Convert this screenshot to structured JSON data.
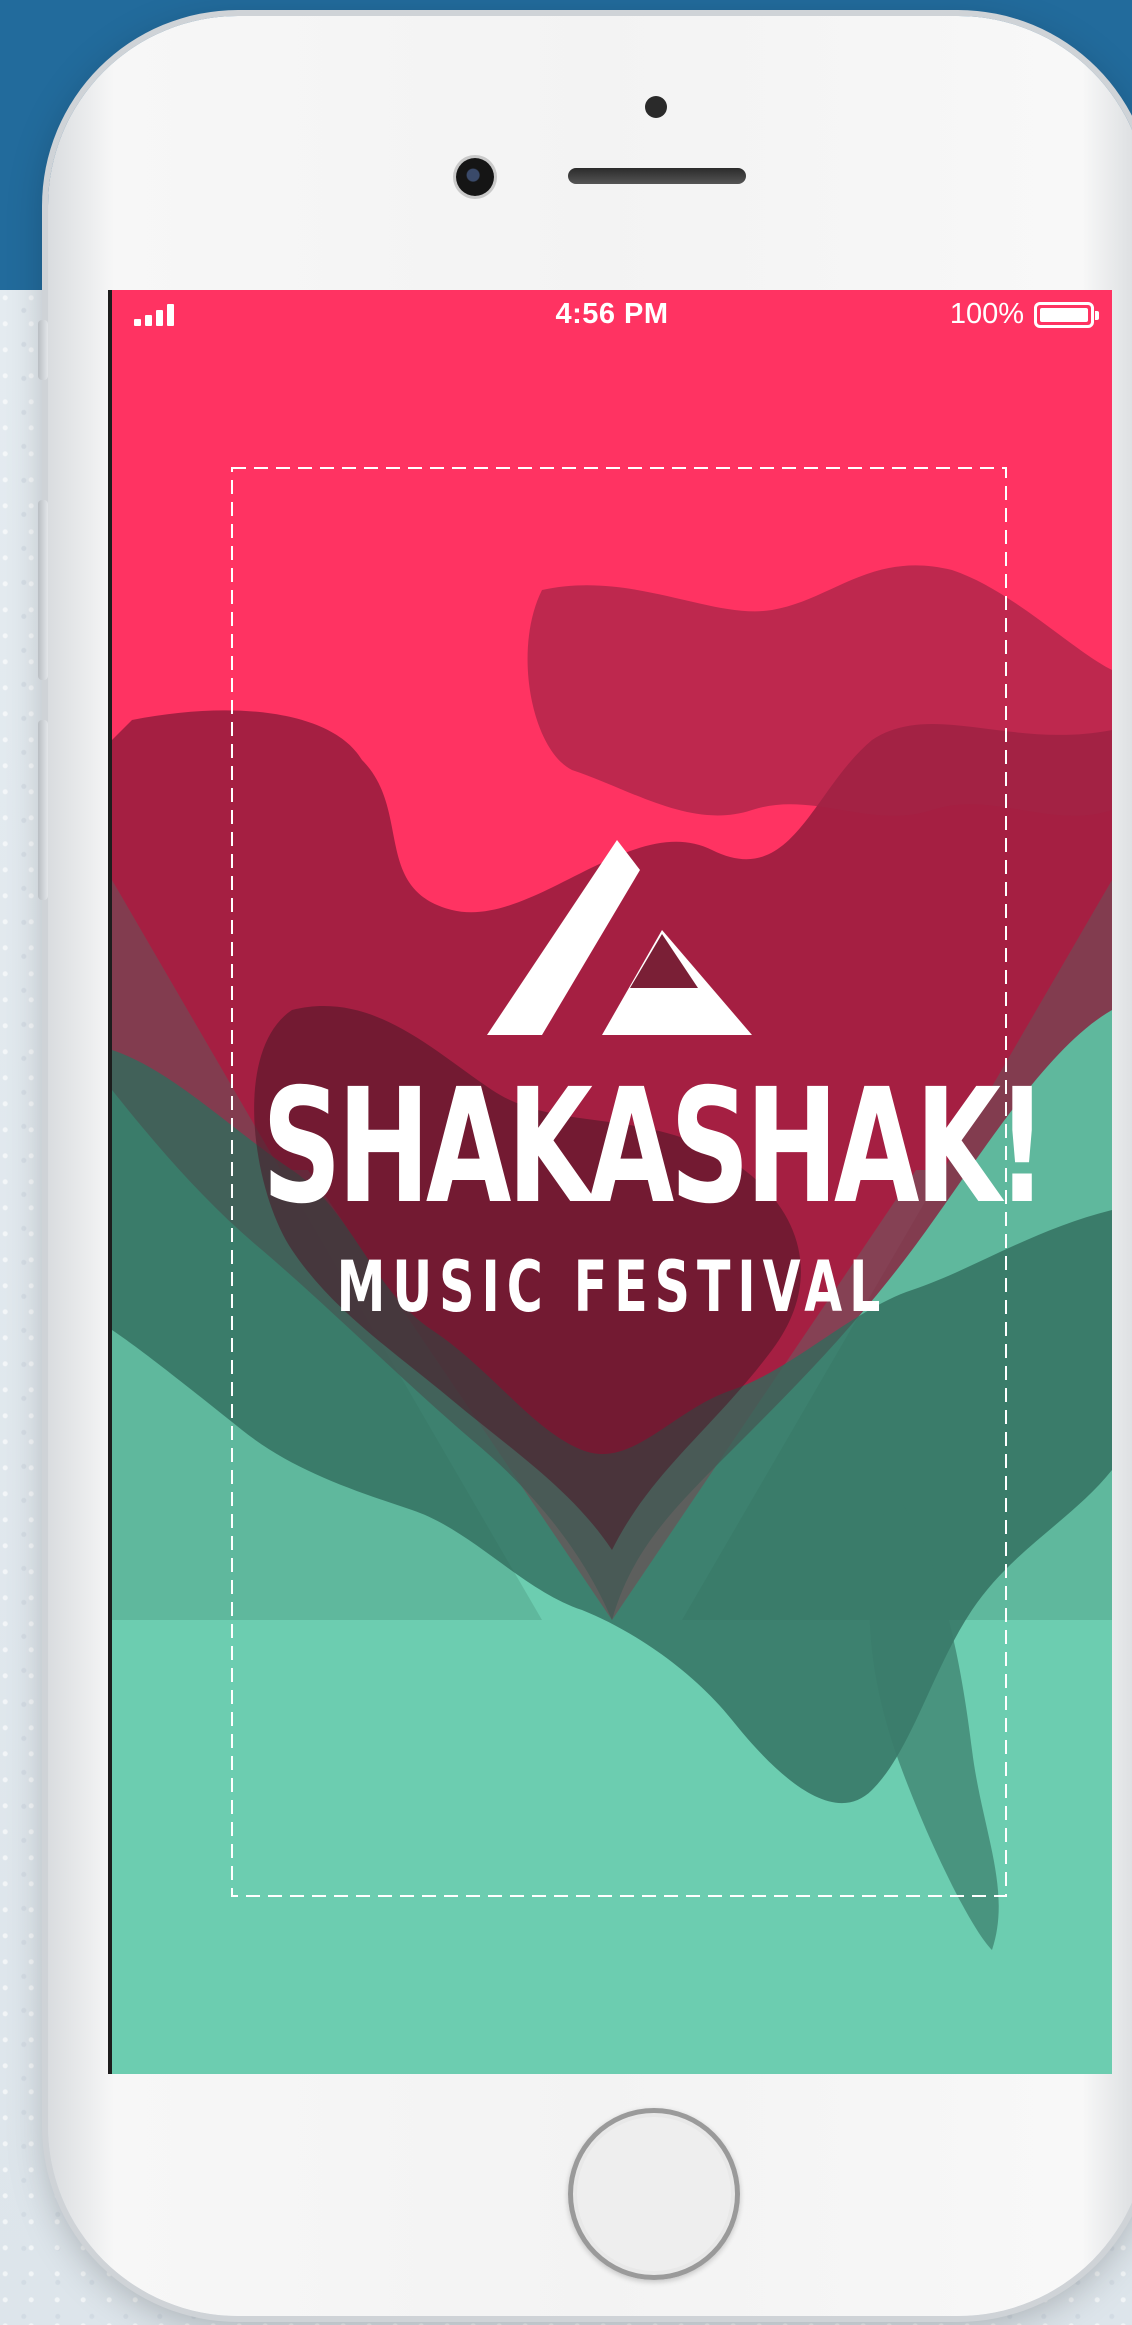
{
  "status_bar": {
    "time": "4:56 PM",
    "battery": "100%"
  },
  "poster": {
    "title": "SHAKASHAK!",
    "subtitle": "MUSIC FESTIVAL"
  },
  "colors": {
    "background_blue": "#226b9c",
    "poster_pink": "#ff3362",
    "poster_teal": "#6ccdb0",
    "poster_dark_green": "#2f6b5c",
    "poster_maroon": "#8c1a3a",
    "text_white": "#ffffff"
  },
  "icons": [
    "signal-icon",
    "battery-icon",
    "triangle-logo-icon"
  ]
}
